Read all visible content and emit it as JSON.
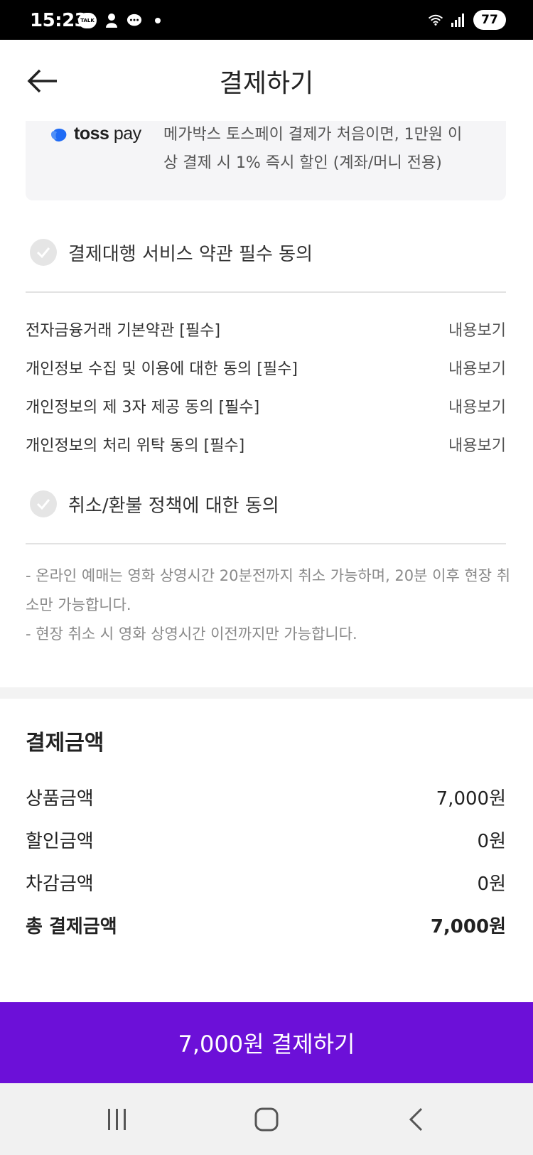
{
  "status_bar": {
    "time": "15:23",
    "talk_badge": "TALK",
    "battery": "77"
  },
  "header": {
    "title": "결제하기",
    "back_icon": "arrow-left-icon"
  },
  "toss": {
    "logo_bold": "toss",
    "logo_light": " pay",
    "description": "메가박스 토스페이 결제가 처음이면, 1만원 이상 결제 시 1% 즉시 할인 (계좌/머니 전용)"
  },
  "agreements": {
    "payment_service": "결제대행 서비스 약관 필수 동의",
    "terms": [
      {
        "label": "전자금융거래 기본약관 [필수]",
        "link": "내용보기"
      },
      {
        "label": "개인정보 수집 및 이용에 대한 동의 [필수]",
        "link": "내용보기"
      },
      {
        "label": "개인정보의 제 3자 제공 동의 [필수]",
        "link": "내용보기"
      },
      {
        "label": "개인정보의 처리 위탁 동의 [필수]",
        "link": "내용보기"
      }
    ],
    "refund_policy": "취소/환불 정책에 대한 동의",
    "policy_lines": [
      "- 온라인 예매는 영화 상영시간 20분전까지 취소 가능하며, 20분 이후 현장 취소만 가능합니다.",
      "- 현장 취소 시 영화 상영시간 이전까지만 가능합니다."
    ]
  },
  "payment": {
    "title": "결제금액",
    "rows": [
      {
        "label": "상품금액",
        "value": "7,000원"
      },
      {
        "label": "할인금액",
        "value": "0원"
      },
      {
        "label": "차감금액",
        "value": "0원"
      }
    ],
    "total_label": "총 결제금액",
    "total_value": "7,000원"
  },
  "cta": {
    "label": "7,000원 결제하기"
  },
  "colors": {
    "accent": "#6c10d8",
    "toss_blue": "#1f6bf5",
    "check_bg": "#e5e5e5"
  },
  "nav": {
    "recent_icon": "recent-apps-icon",
    "home_icon": "home-icon",
    "back_icon": "back-icon"
  }
}
